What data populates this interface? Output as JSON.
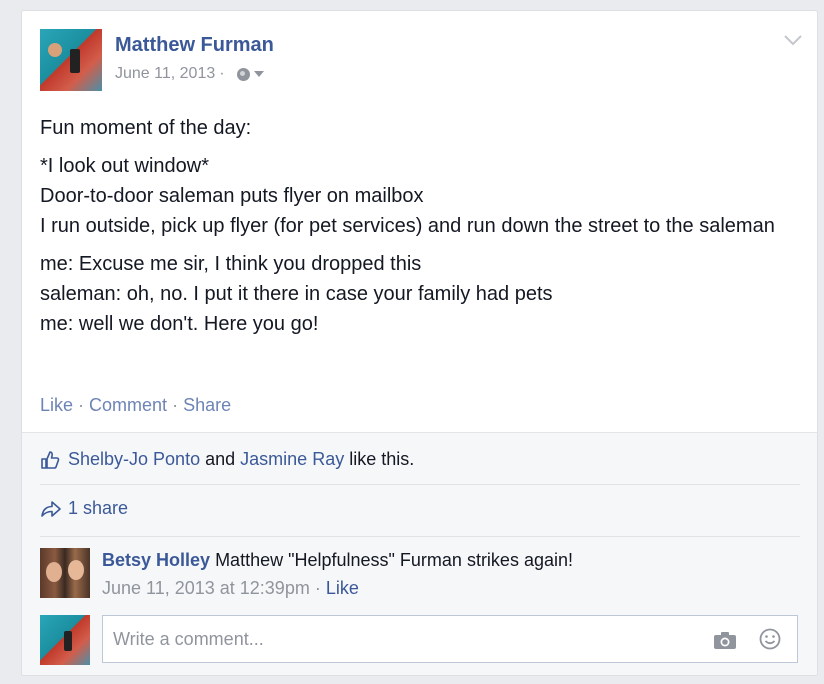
{
  "post": {
    "author": "Matthew Furman",
    "date": "June 11, 2013",
    "separator": "·",
    "privacy_icon": "globe-icon",
    "menu_icon": "chevron-down-icon",
    "paragraphs": [
      [
        "Fun moment of the day:"
      ],
      [
        "*I look out window*",
        "Door-to-door saleman puts flyer on mailbox",
        "I run outside, pick up flyer (for pet services) and run down the street to the saleman"
      ],
      [
        "me: Excuse me sir, I think you dropped this",
        "saleman: oh, no. I put it there in case your family had pets",
        "me: well we don't. Here you go!"
      ]
    ],
    "actions": {
      "like": "Like",
      "comment": "Comment",
      "share": "Share",
      "dot": "·"
    }
  },
  "reactions": {
    "icon": "thumbs-up-icon",
    "liker1": "Shelby-Jo Ponto",
    "and": "and",
    "liker2": "Jasmine Ray",
    "suffix": "like this."
  },
  "shares": {
    "icon": "share-arrow-icon",
    "label": "1 share"
  },
  "comment": {
    "author": "Betsy Holley",
    "text": "Matthew \"Helpfulness\" Furman strikes again!",
    "timestamp": "June 11, 2013 at 12:39pm",
    "dot": "·",
    "like": "Like"
  },
  "composer": {
    "placeholder": "Write a comment...",
    "camera_icon": "camera-icon",
    "emoji_icon": "smiley-icon"
  },
  "colors": {
    "link": "#3b5998",
    "muted": "#90949c",
    "background": "#e9ebee"
  }
}
